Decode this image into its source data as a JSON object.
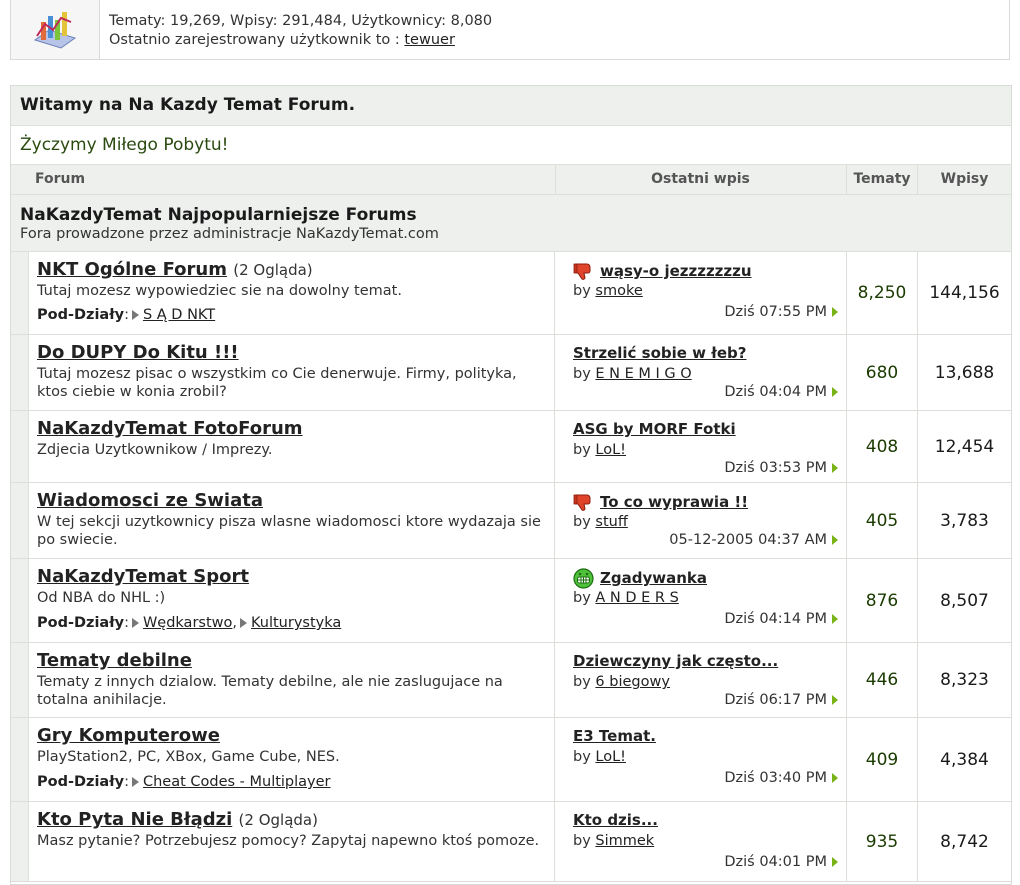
{
  "stats": {
    "line1": "Tematy: 19,269, Wpisy: 291,484, Użytkownicy: 8,080",
    "line2_prefix": "Ostatnio zarejestrowany użytkownik to :",
    "newest_user": "tewuer",
    "icon": "stats-chart-icon"
  },
  "welcome": "Witamy na Na Kazdy Temat Forum.",
  "motd": "Życzymy Miłego Pobytu!",
  "columns": {
    "forum": "Forum",
    "last_post": "Ostatni wpis",
    "topics": "Tematy",
    "posts": "Wpisy"
  },
  "category": {
    "title": "NaKazdyTemat Najpopularniejsze Forums",
    "desc": "Fora prowadzone przez administracje NaKazdyTemat.com"
  },
  "subforums_label": "Pod-Działy",
  "by_label": "by",
  "forums": [
    {
      "title": "NKT Ogólne Forum",
      "views": "(2 Ogląda)",
      "desc": "Tutaj mozesz wypowiedziec sie na dowolny temat.",
      "subs": [
        "S Ą D NKT"
      ],
      "last_topic": "wąsy-o jezzzzzzzu",
      "last_icon": "thumbs-down-icon",
      "last_by": "smoke",
      "last_date": "Dziś 07:55 PM",
      "topics": "8,250",
      "posts": "144,156"
    },
    {
      "title": "Do DUPY Do Kitu !!!",
      "views": "",
      "desc": "Tutaj mozesz pisac o wszystkim co Cie denerwuje. Firmy, polityka, ktos ciebie w konia zrobil?",
      "subs": [],
      "last_topic": "Strzelić sobie w łeb?",
      "last_icon": "",
      "last_by": "E N E M I G O",
      "last_date": "Dziś 04:04 PM",
      "topics": "680",
      "posts": "13,688"
    },
    {
      "title": "NaKazdyTemat FotoForum",
      "views": "",
      "desc": "Zdjecia Uzytkownikow / Imprezy.",
      "subs": [],
      "last_topic": "ASG by MORF Fotki",
      "last_icon": "",
      "last_by": "LoL!",
      "last_date": "Dziś 03:53 PM",
      "topics": "408",
      "posts": "12,454"
    },
    {
      "title": "Wiadomosci ze Swiata",
      "views": "",
      "desc": "W tej sekcji uzytkownicy pisza wlasne wiadomosci ktore wydazaja sie po swiecie.",
      "subs": [],
      "last_topic": "To co wyprawia !!",
      "last_icon": "thumbs-down-icon",
      "last_by": "stuff",
      "last_date": "05-12-2005 04:37 AM",
      "topics": "405",
      "posts": "3,783"
    },
    {
      "title": "NaKazdyTemat Sport",
      "views": "",
      "desc": "Od NBA do NHL :)",
      "subs": [
        "Wędkarstwo",
        "Kulturystyka"
      ],
      "last_topic": "Zgadywanka",
      "last_icon": "grin-icon",
      "last_by": "A N D E R S",
      "last_date": "Dziś 04:14 PM",
      "topics": "876",
      "posts": "8,507"
    },
    {
      "title": "Tematy debilne",
      "views": "",
      "desc": "Tematy z innych dzialow. Tematy debilne, ale nie zaslugujace na totalna anihilacje.",
      "subs": [],
      "last_topic": "Dziewczyny jak często...",
      "last_icon": "",
      "last_by": "6 biegowy",
      "last_date": "Dziś 06:17 PM",
      "topics": "446",
      "posts": "8,323"
    },
    {
      "title": "Gry Komputerowe",
      "views": "",
      "desc": "PlayStation2, PC, XBox, Game Cube, NES.",
      "subs": [
        "Cheat Codes - Multiplayer"
      ],
      "last_topic": "E3 Temat.",
      "last_icon": "",
      "last_by": "LoL!",
      "last_date": "Dziś 03:40 PM",
      "topics": "409",
      "posts": "4,384"
    },
    {
      "title": "Kto Pyta Nie Błądzi",
      "views": "(2 Ogląda)",
      "desc": "Masz pytanie? Potrzebujesz pomocy? Zapytaj napewno ktoś pomoze.",
      "subs": [],
      "last_topic": "Kto dzis...",
      "last_icon": "",
      "last_by": "Simmek",
      "last_date": "Dziś 04:01 PM",
      "topics": "935",
      "posts": "8,742"
    }
  ]
}
